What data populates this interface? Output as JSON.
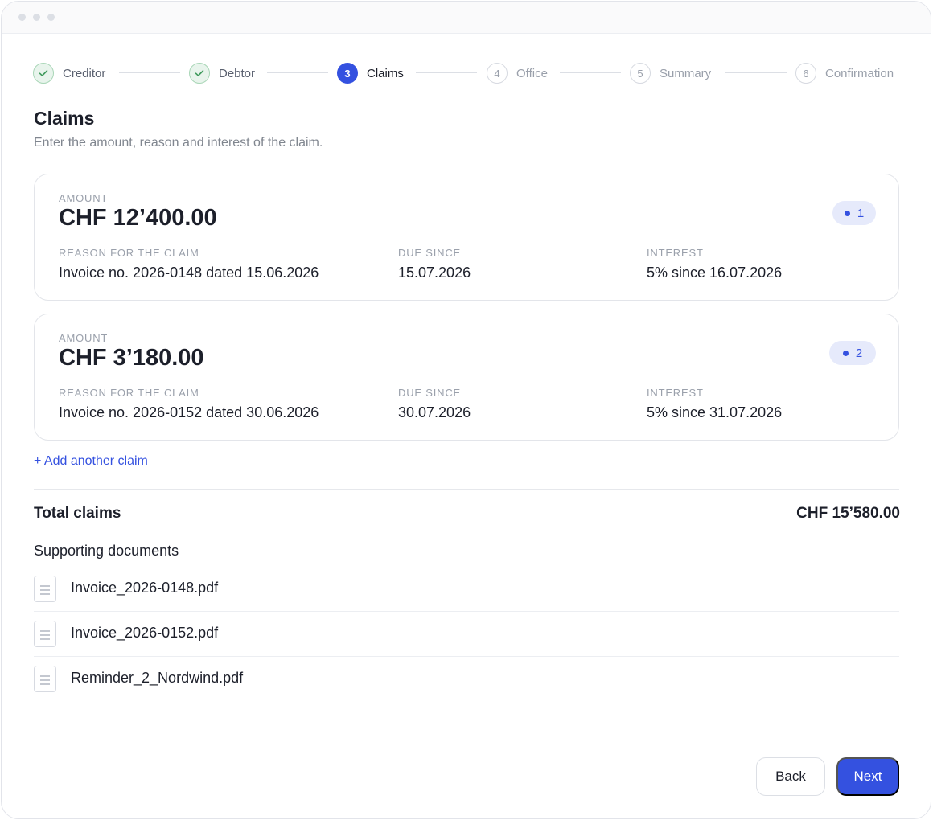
{
  "stepper": {
    "steps": [
      {
        "number": "1",
        "label": "Creditor",
        "state": "done"
      },
      {
        "number": "2",
        "label": "Debtor",
        "state": "done"
      },
      {
        "number": "3",
        "label": "Claims",
        "state": "active"
      },
      {
        "number": "4",
        "label": "Office",
        "state": "todo"
      },
      {
        "number": "5",
        "label": "Summary",
        "state": "todo"
      },
      {
        "number": "6",
        "label": "Confirmation",
        "state": "todo"
      }
    ],
    "done_icon": "check-icon"
  },
  "page": {
    "title": "Claims",
    "subtitle": "Enter the amount, reason and interest of the claim."
  },
  "claims": [
    {
      "amount_label": "AMOUNT",
      "amount": "CHF 12’400.00",
      "badge": "1",
      "reason_label": "REASON FOR THE CLAIM",
      "reason": "Invoice no. 2026-0148 dated 15.06.2026",
      "due_label": "DUE SINCE",
      "due": "15.07.2026",
      "interest_label": "INTEREST",
      "interest": "5% since 16.07.2026"
    },
    {
      "amount_label": "AMOUNT",
      "amount": "CHF 3’180.00",
      "badge": "2",
      "reason_label": "REASON FOR THE CLAIM",
      "reason": "Invoice no. 2026-0152 dated 30.06.2026",
      "due_label": "DUE SINCE",
      "due": "30.07.2026",
      "interest_label": "INTEREST",
      "interest": "5% since 31.07.2026"
    }
  ],
  "add_claim_label": "+ Add another claim",
  "totals": {
    "label": "Total claims",
    "value": "CHF 15’580.00"
  },
  "documents": {
    "title": "Supporting documents",
    "icon": "document-icon",
    "files": [
      {
        "name": "Invoice_2026-0148.pdf"
      },
      {
        "name": "Invoice_2026-0152.pdf"
      },
      {
        "name": "Reminder_2_Nordwind.pdf"
      }
    ]
  },
  "footer": {
    "back_label": "Back",
    "next_label": "Next"
  },
  "colors": {
    "accent": "#3451e0",
    "done_green": "#3f9a5c"
  }
}
